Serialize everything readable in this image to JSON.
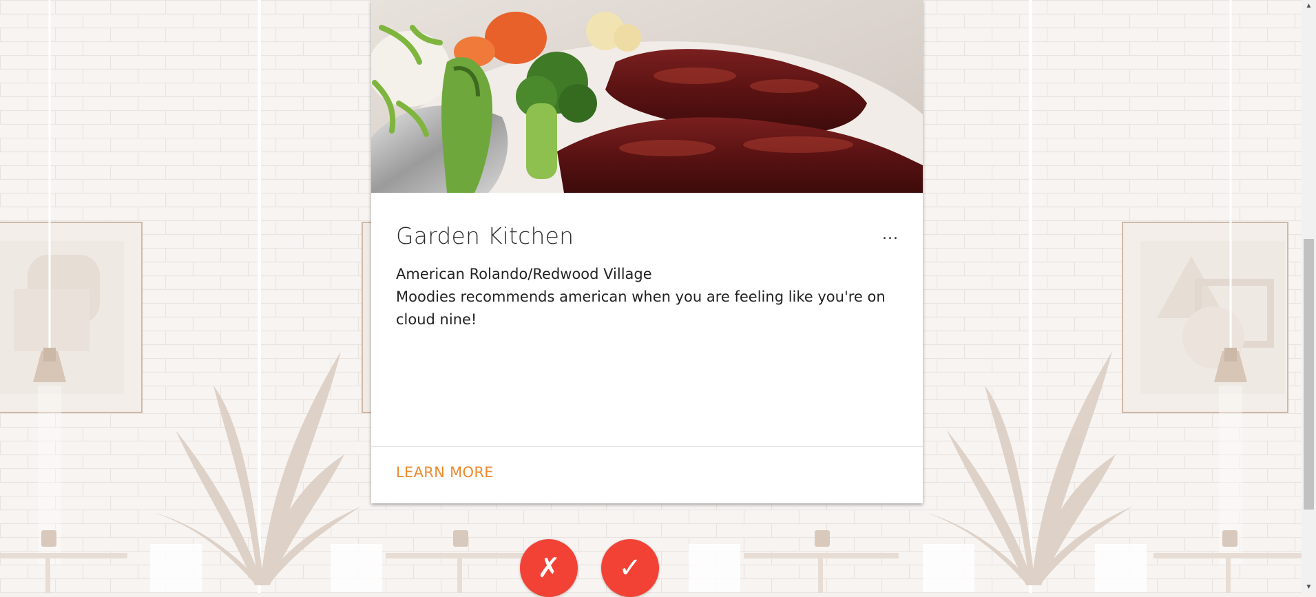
{
  "card": {
    "title": "Garden Kitchen",
    "subtitle": "American Rolando/Redwood Village",
    "description": "Moodies recommends american when you are feeling like you're on cloud nine!",
    "more_label": "...",
    "learn_more_label": "LEARN MORE",
    "image_icon": "restaurant-food-photo"
  },
  "actions": {
    "reject_label": "✗",
    "accept_label": "✓",
    "reject_icon": "x-icon",
    "accept_icon": "check-icon"
  },
  "colors": {
    "accent": "#f0892c",
    "button": "#f24236",
    "background": "#f4f1ee"
  }
}
